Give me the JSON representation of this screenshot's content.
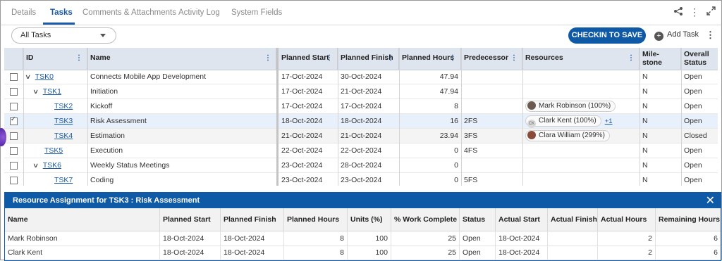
{
  "tabs": [
    {
      "label": "Details"
    },
    {
      "label": "Tasks"
    },
    {
      "label": "Comments & Attachments"
    },
    {
      "label": "Activity Log"
    },
    {
      "label": "System Fields"
    }
  ],
  "toolbar": {
    "filter_value": "All Tasks",
    "checkin_label": "CHECKIN TO SAVE",
    "add_task_label": "Add Task"
  },
  "grid": {
    "headers": {
      "id": "ID",
      "name": "Name",
      "planned_start": "Planned Start",
      "planned_finish": "Planned Finish",
      "planned_hours": "Planned Hours",
      "predecessor": "Predecessor",
      "resources": "Resources",
      "milestone": "Mile- stone",
      "overall_status": "Overall Status"
    },
    "rows": [
      {
        "id": "TSK0",
        "name": "Connects Mobile App Development",
        "start": "17-Oct-2024",
        "finish": "30-Oct-2024",
        "hours": "47.94",
        "pred": "",
        "resource": "",
        "more": "",
        "milestone": "N",
        "status": "Open"
      },
      {
        "id": "TSK1",
        "name": "Initiation",
        "start": "17-Oct-2024",
        "finish": "21-Oct-2024",
        "hours": "47.94",
        "pred": "",
        "resource": "",
        "more": "",
        "milestone": "N",
        "status": "Open"
      },
      {
        "id": "TSK2",
        "name": "Kickoff",
        "start": "17-Oct-2024",
        "finish": "17-Oct-2024",
        "hours": "8",
        "pred": "",
        "resource": "Mark Robinson (100%)",
        "more": "",
        "milestone": "N",
        "status": "Open"
      },
      {
        "id": "TSK3",
        "name": "Risk Assessment",
        "start": "18-Oct-2024",
        "finish": "18-Oct-2024",
        "hours": "16",
        "pred": "2FS",
        "resource": "Clark Kent (100%)",
        "more": "+1",
        "avatar_text": "CK",
        "milestone": "N",
        "status": "Open"
      },
      {
        "id": "TSK4",
        "name": "Estimation",
        "start": "21-Oct-2024",
        "finish": "21-Oct-2024",
        "hours": "23.94",
        "pred": "3FS",
        "resource": "Clara William (299%)",
        "more": "",
        "milestone": "N",
        "status": "Closed"
      },
      {
        "id": "TSK5",
        "name": "Execution",
        "start": "22-Oct-2024",
        "finish": "22-Oct-2024",
        "hours": "0",
        "pred": "4FS",
        "resource": "",
        "more": "",
        "milestone": "N",
        "status": "Open"
      },
      {
        "id": "TSK6",
        "name": "Weekly Status Meetings",
        "start": "23-Oct-2024",
        "finish": "28-Oct-2024",
        "hours": "0",
        "pred": "",
        "resource": "",
        "more": "",
        "milestone": "N",
        "status": "Open"
      },
      {
        "id": "TSK7",
        "name": "Coding",
        "start": "23-Oct-2024",
        "finish": "23-Oct-2024",
        "hours": "0",
        "pred": "5FS",
        "resource": "",
        "more": "",
        "milestone": "N",
        "status": "Open"
      }
    ]
  },
  "resource_panel": {
    "title": "Resource Assignment for TSK3 : Risk Assessment",
    "headers": [
      "Name",
      "Planned Start",
      "Planned Finish",
      "Planned Hours",
      "Units (%)",
      "% Work Complete",
      "Status",
      "Actual Start",
      "Actual Finish",
      "Actual Hours",
      "Remaining Hours"
    ],
    "rows": [
      [
        "Mark Robinson",
        "18-Oct-2024",
        "18-Oct-2024",
        "8",
        "100",
        "25",
        "Open",
        "18-Oct-2024",
        "",
        "2",
        "6"
      ],
      [
        "Clark Kent",
        "18-Oct-2024",
        "18-Oct-2024",
        "8",
        "100",
        "25",
        "Open",
        "18-Oct-2024",
        "",
        "2",
        "6"
      ]
    ]
  },
  "icons": [
    "share-icon",
    "more-vertical-icon",
    "expand-icon",
    "add-circle-icon",
    "close-icon",
    "chevron-down-icon",
    "checkbox-icon",
    "avatar-icon"
  ],
  "colors": {
    "accent": "#0f5aa7",
    "header_bg": "#dfe5ee",
    "selected_row": "#e8f0fb"
  }
}
